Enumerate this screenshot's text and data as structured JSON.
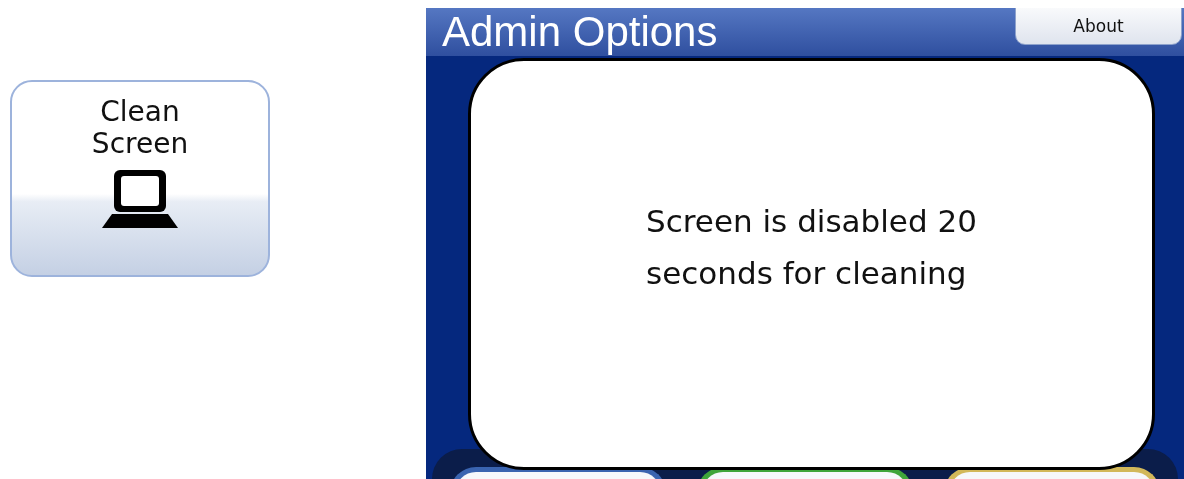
{
  "clean_button": {
    "label_lines": [
      "Clean",
      "Screen"
    ]
  },
  "screen": {
    "title": "Admin Options",
    "about_button": "About",
    "dialog": {
      "message_lines": [
        "Screen is disabled 20",
        "seconds for cleaning"
      ]
    },
    "bottom_buttons": [
      {
        "color": "#3a64b0"
      },
      {
        "color": "#3fa53a"
      },
      {
        "color": "#d2b85a"
      }
    ]
  }
}
